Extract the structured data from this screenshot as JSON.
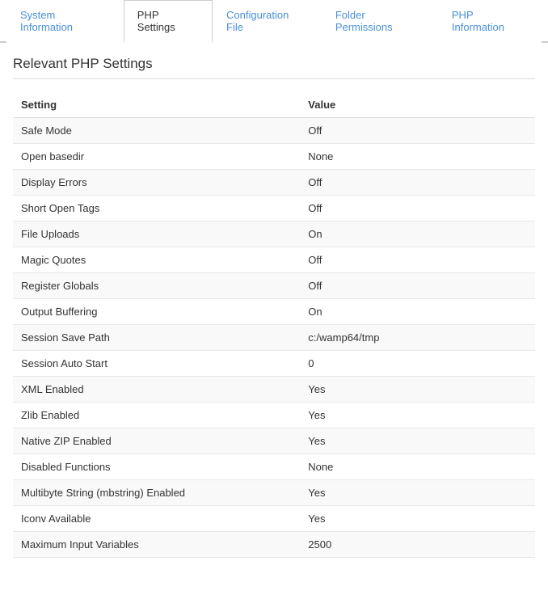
{
  "tabs": [
    {
      "id": "system-information",
      "label": "System Information",
      "active": false
    },
    {
      "id": "php-settings",
      "label": "PHP Settings",
      "active": true
    },
    {
      "id": "configuration-file",
      "label": "Configuration File",
      "active": false
    },
    {
      "id": "folder-permissions",
      "label": "Folder Permissions",
      "active": false
    },
    {
      "id": "php-information",
      "label": "PHP Information",
      "active": false
    }
  ],
  "section_title": "Relevant PHP Settings",
  "table": {
    "columns": [
      {
        "id": "setting",
        "label": "Setting"
      },
      {
        "id": "value",
        "label": "Value"
      }
    ],
    "rows": [
      {
        "setting": "Safe Mode",
        "value": "Off"
      },
      {
        "setting": "Open basedir",
        "value": "None"
      },
      {
        "setting": "Display Errors",
        "value": "Off"
      },
      {
        "setting": "Short Open Tags",
        "value": "Off"
      },
      {
        "setting": "File Uploads",
        "value": "On"
      },
      {
        "setting": "Magic Quotes",
        "value": "Off"
      },
      {
        "setting": "Register Globals",
        "value": "Off"
      },
      {
        "setting": "Output Buffering",
        "value": "On"
      },
      {
        "setting": "Session Save Path",
        "value": "c:/wamp64/tmp"
      },
      {
        "setting": "Session Auto Start",
        "value": "0"
      },
      {
        "setting": "XML Enabled",
        "value": "Yes"
      },
      {
        "setting": "Zlib Enabled",
        "value": "Yes"
      },
      {
        "setting": "Native ZIP Enabled",
        "value": "Yes"
      },
      {
        "setting": "Disabled Functions",
        "value": "None"
      },
      {
        "setting": "Multibyte String (mbstring) Enabled",
        "value": "Yes"
      },
      {
        "setting": "Iconv Available",
        "value": "Yes"
      },
      {
        "setting": "Maximum Input Variables",
        "value": "2500"
      }
    ]
  }
}
